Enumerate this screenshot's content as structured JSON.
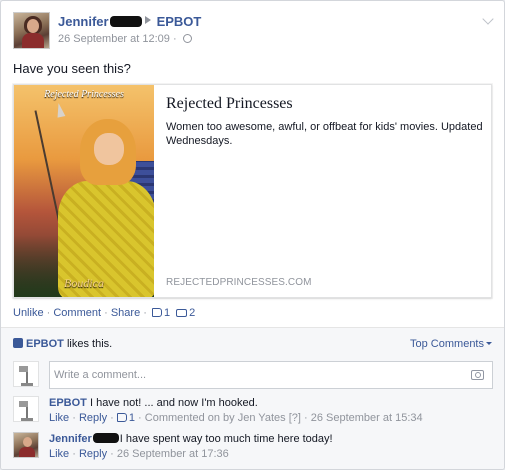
{
  "post": {
    "author": "Jennifer",
    "shared_to": "EPBOT",
    "time": "26 September at 12:09",
    "meta_sep": " · ",
    "message": "Have you seen this?"
  },
  "link_preview": {
    "thumb_title": "Rejected Princesses",
    "thumb_caption": "Boudica",
    "title": "Rejected Princesses",
    "description": "Women too awesome, awful, or offbeat for kids' movies. Updated Wednesdays.",
    "domain": "REJECTEDPRINCESSES.COM"
  },
  "actions": {
    "unlike": "Unlike",
    "comment": "Comment",
    "share": "Share",
    "sep": " · ",
    "like_count": "1",
    "comment_count": "2"
  },
  "ufi": {
    "liker": "EPBOT",
    "likes_text": " likes this.",
    "top_comments": "Top Comments",
    "input_placeholder": "Write a comment...",
    "input_value": ""
  },
  "comments": [
    {
      "author": "EPBOT",
      "text": " I have not! ... and now I'm hooked.",
      "like": "Like",
      "reply": "Reply",
      "likes": "1",
      "note": "Commented on by Jen Yates",
      "qmark": "[?]",
      "time": "26 September at 15:34"
    },
    {
      "author": "Jennifer",
      "text": "I have spent way too much time here today!",
      "like": "Like",
      "reply": "Reply",
      "time": "26 September at 17:36"
    }
  ]
}
